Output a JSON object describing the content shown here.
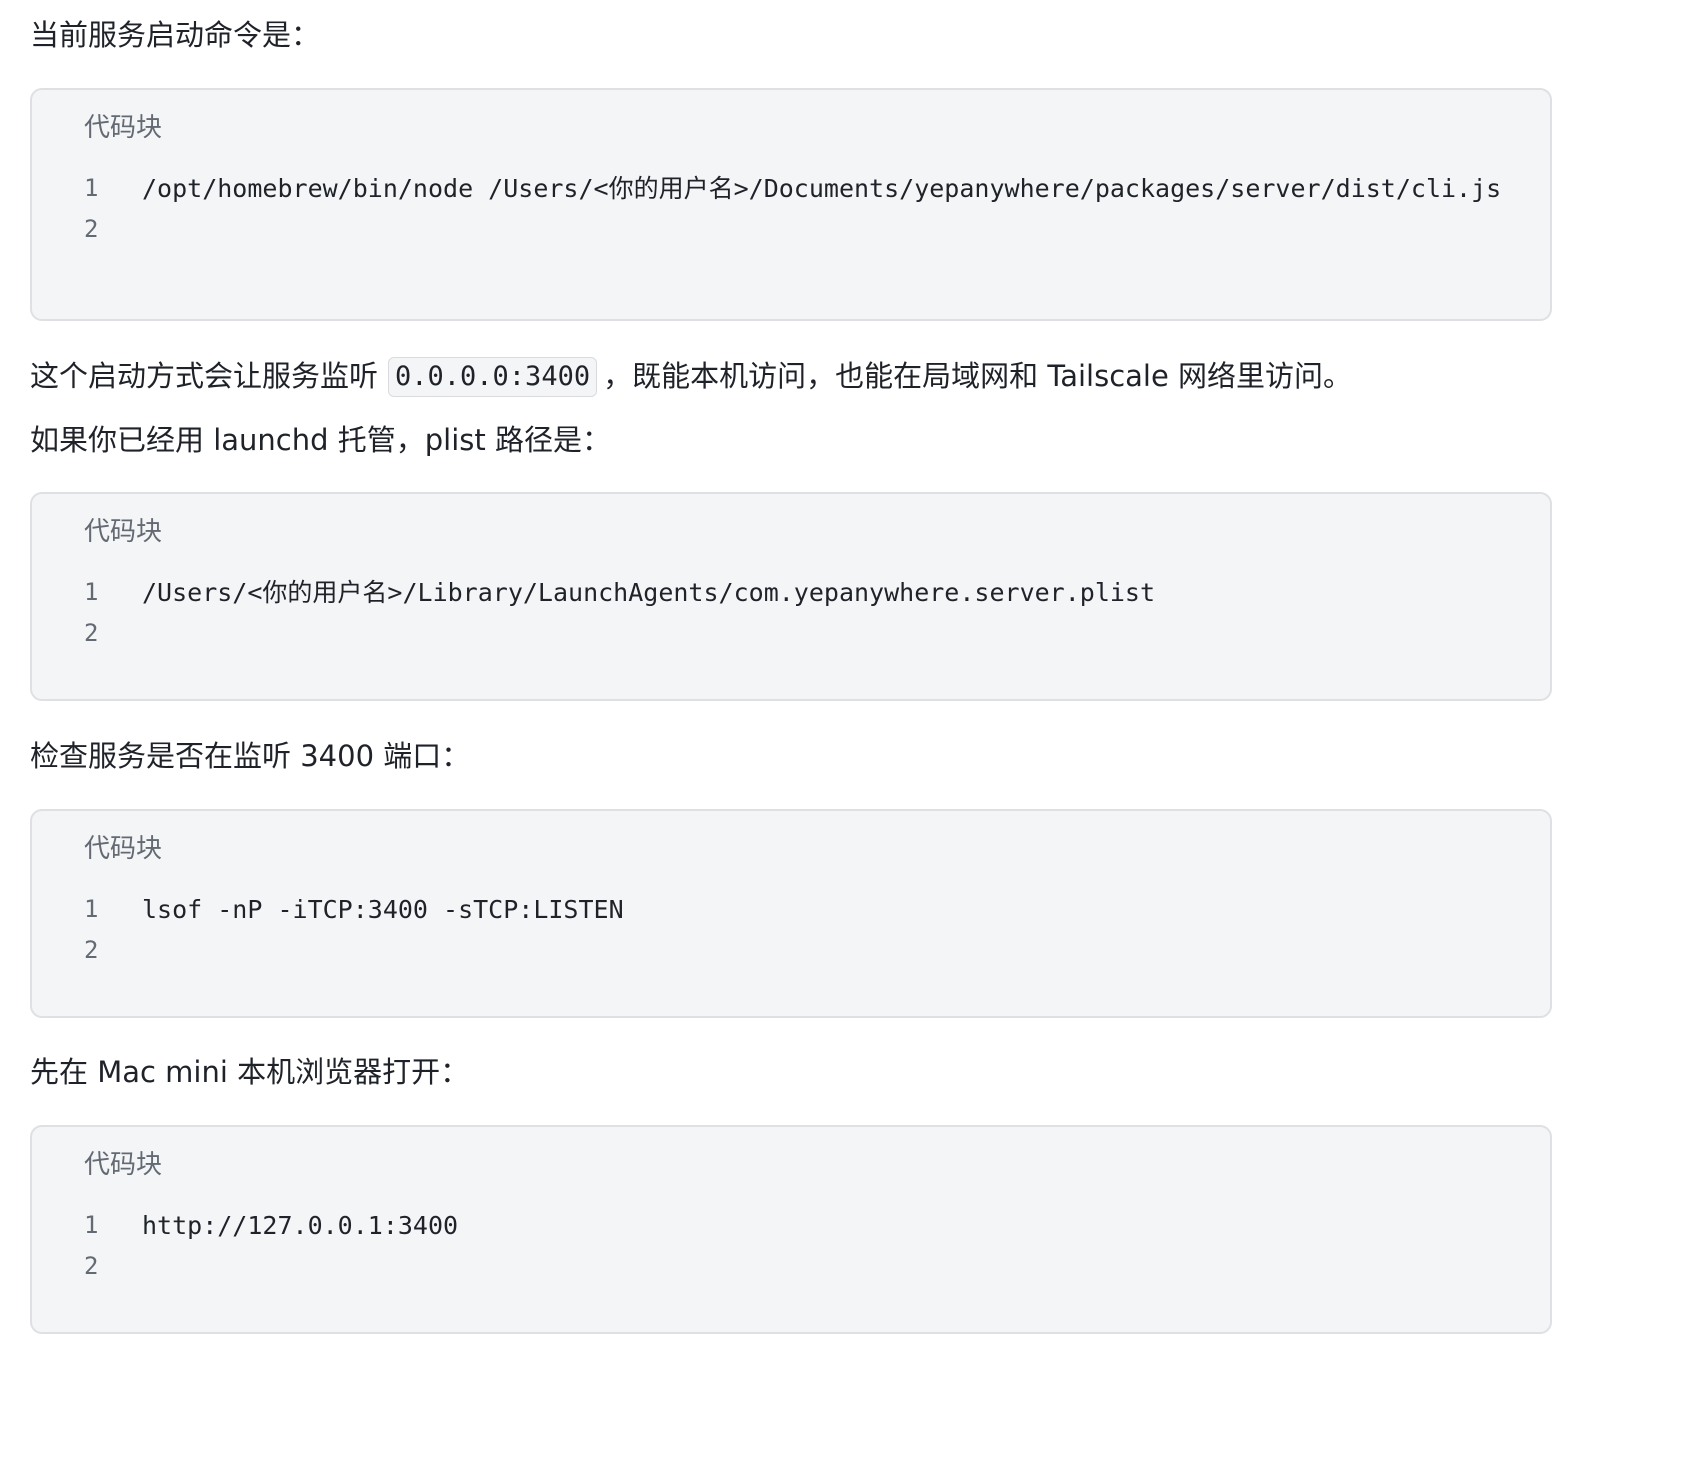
{
  "paragraphs": {
    "p1": "当前服务启动命令是：",
    "p2_before": "这个启动方式会让服务监听",
    "p2_code": "0.0.0.0:3400",
    "p2_after": "，既能本机访问，也能在局域网和 Tailscale 网络里访问。",
    "p3": "如果你已经用 launchd 托管，plist 路径是：",
    "p4": "检查服务是否在监听 3400 端口：",
    "p5": "先在 Mac mini 本机浏览器打开："
  },
  "code_blocks": [
    {
      "title": "代码块",
      "lines": [
        {
          "num": "1",
          "text": "/opt/homebrew/bin/node /Users/<你的用户名>/Documents/yepanywhere/packages/server/dist/cli.js"
        },
        {
          "num": "2",
          "text": ""
        }
      ]
    },
    {
      "title": "代码块",
      "lines": [
        {
          "num": "1",
          "text": "/Users/<你的用户名>/Library/LaunchAgents/com.yepanywhere.server.plist"
        },
        {
          "num": "2",
          "text": ""
        }
      ]
    },
    {
      "title": "代码块",
      "lines": [
        {
          "num": "1",
          "text": "lsof -nP -iTCP:3400 -sTCP:LISTEN"
        },
        {
          "num": "2",
          "text": ""
        }
      ]
    },
    {
      "title": "代码块",
      "lines": [
        {
          "num": "1",
          "text": "http://127.0.0.1:3400"
        },
        {
          "num": "2",
          "text": ""
        }
      ]
    }
  ]
}
